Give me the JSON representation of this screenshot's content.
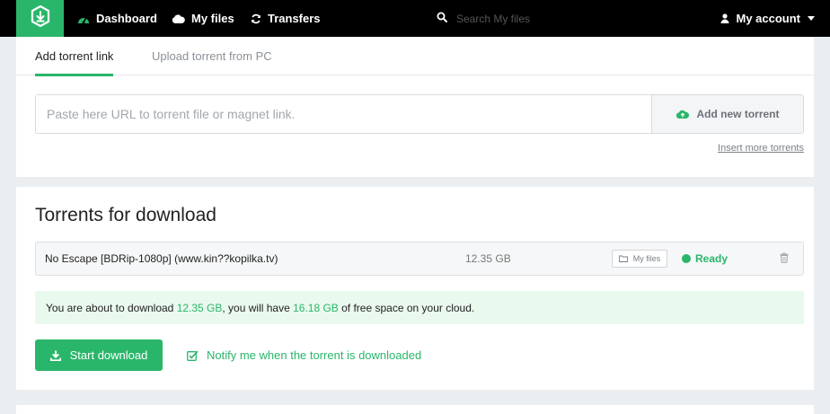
{
  "colors": {
    "accent": "#2ab66a",
    "navbar_bg": "#000000",
    "page_bg": "#ebeef0",
    "info_bg": "#eaf9ee"
  },
  "navbar": {
    "logo_icon": "download-shield-icon",
    "items": [
      {
        "label": "Dashboard",
        "icon": "dashboard-icon"
      },
      {
        "label": "My files",
        "icon": "cloud-icon"
      },
      {
        "label": "Transfers",
        "icon": "refresh-icon"
      }
    ],
    "search": {
      "placeholder": "Search My files",
      "icon": "search-icon"
    },
    "account": {
      "label": "My account",
      "icon": "user-icon"
    }
  },
  "add_torrent": {
    "tabs": [
      {
        "label": "Add torrent link",
        "active": true
      },
      {
        "label": "Upload torrent from PC",
        "active": false
      }
    ],
    "url_input": {
      "placeholder": "Paste here URL to torrent file or magnet link.",
      "value": ""
    },
    "add_button": "Add new torrent",
    "insert_more": "Insert more torrents"
  },
  "torrents": {
    "title": "Torrents for download",
    "items": [
      {
        "name": "No Escape [BDRip-1080p] (www.kin??kopilka.tv)",
        "size": "12.35 GB",
        "myfiles_label": "My files",
        "status": "Ready"
      }
    ],
    "info": {
      "prefix": "You are about to download ",
      "download_size": "12.35 GB",
      "middle": ", you will have ",
      "free_space": "16.18 GB",
      "suffix": " of free space on your cloud."
    },
    "start_button": "Start download",
    "notify_label": "Notify me when the torrent is downloaded",
    "notify_checked": true
  }
}
